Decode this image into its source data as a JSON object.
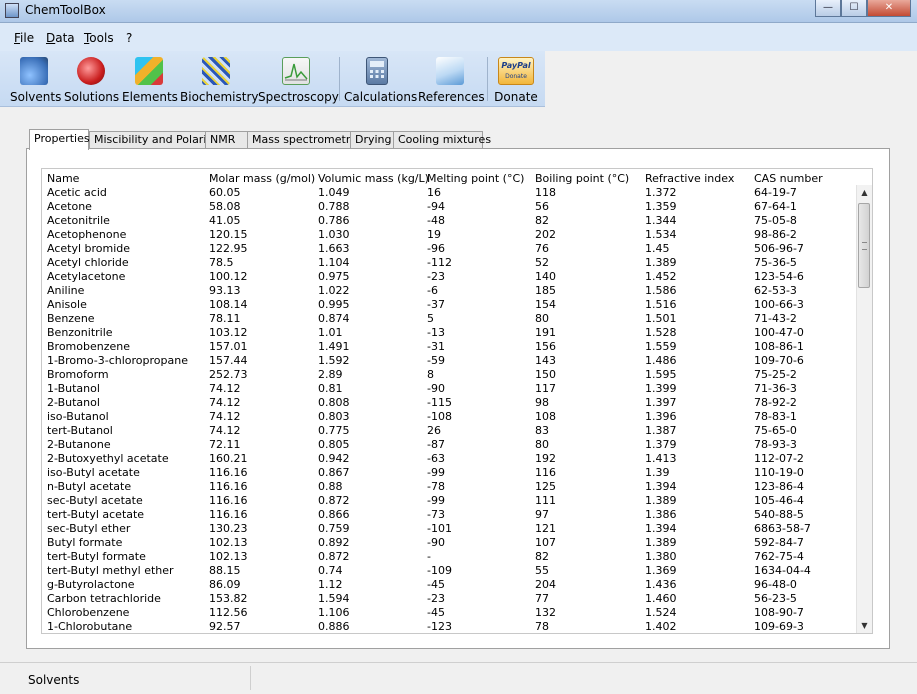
{
  "window": {
    "title": "ChemToolBox",
    "controls": {
      "minimize": "—",
      "maximize": "☐",
      "close": "✕"
    }
  },
  "menu": [
    "File",
    "Data",
    "Tools",
    "?"
  ],
  "toolbar": [
    {
      "label": "Solvents",
      "icon": "solvents-flask-icon",
      "color": "#5b8fd0"
    },
    {
      "label": "Solutions",
      "icon": "solutions-molecule-icon",
      "color": "#d23b3b"
    },
    {
      "label": "Elements",
      "icon": "elements-cubes-icon",
      "color": "#2fa8d6"
    },
    {
      "label": "Biochemistry",
      "icon": "biochemistry-dna-icon",
      "color": "#3b6fc2"
    },
    {
      "label": "Spectroscopy",
      "icon": "spectroscopy-graph-icon",
      "color": "#49a34b"
    },
    {
      "label": "Calculations",
      "icon": "calculator-icon",
      "color": "#6f8db3"
    },
    {
      "label": "References",
      "icon": "references-book-icon",
      "color": "#5b9ad6"
    },
    {
      "label": "Donate",
      "icon": "paypal-donate-icon",
      "color": "#e9a32e",
      "badge_top": "PayPal",
      "badge_bottom": "Donate"
    }
  ],
  "tabs": [
    "Properties",
    "Miscibility and Polarity",
    "NMR",
    "Mass spectrometry",
    "Drying",
    "Cooling mixtures"
  ],
  "active_tab": "Properties",
  "table": {
    "columns": [
      "Name",
      "Molar mass (g/mol)",
      "Volumic mass (kg/L)",
      "Melting point (°C)",
      "Boiling point (°C)",
      "Refractive index",
      "CAS number"
    ],
    "rows": [
      [
        "Acetic acid",
        "60.05",
        "1.049",
        "16",
        "118",
        "1.372",
        "64-19-7"
      ],
      [
        "Acetone",
        "58.08",
        "0.788",
        "-94",
        "56",
        "1.359",
        "67-64-1"
      ],
      [
        "Acetonitrile",
        "41.05",
        "0.786",
        "-48",
        "82",
        "1.344",
        "75-05-8"
      ],
      [
        "Acetophenone",
        "120.15",
        "1.030",
        "19",
        "202",
        "1.534",
        "98-86-2"
      ],
      [
        "Acetyl bromide",
        "122.95",
        "1.663",
        "-96",
        "76",
        "1.45",
        "506-96-7"
      ],
      [
        "Acetyl chloride",
        "78.5",
        "1.104",
        "-112",
        "52",
        "1.389",
        "75-36-5"
      ],
      [
        "Acetylacetone",
        "100.12",
        "0.975",
        "-23",
        "140",
        "1.452",
        "123-54-6"
      ],
      [
        "Aniline",
        "93.13",
        "1.022",
        "-6",
        "185",
        "1.586",
        "62-53-3"
      ],
      [
        "Anisole",
        "108.14",
        "0.995",
        "-37",
        "154",
        "1.516",
        "100-66-3"
      ],
      [
        "Benzene",
        "78.11",
        "0.874",
        "5",
        "80",
        "1.501",
        "71-43-2"
      ],
      [
        "Benzonitrile",
        "103.12",
        "1.01",
        "-13",
        "191",
        "1.528",
        "100-47-0"
      ],
      [
        "Bromobenzene",
        "157.01",
        "1.491",
        "-31",
        "156",
        "1.559",
        "108-86-1"
      ],
      [
        "1-Bromo-3-chloropropane",
        "157.44",
        "1.592",
        "-59",
        "143",
        "1.486",
        "109-70-6"
      ],
      [
        "Bromoform",
        "252.73",
        "2.89",
        "8",
        "150",
        "1.595",
        "75-25-2"
      ],
      [
        "1-Butanol",
        "74.12",
        "0.81",
        "-90",
        "117",
        "1.399",
        "71-36-3"
      ],
      [
        "2-Butanol",
        "74.12",
        "0.808",
        "-115",
        "98",
        "1.397",
        "78-92-2"
      ],
      [
        "iso-Butanol",
        "74.12",
        "0.803",
        "-108",
        "108",
        "1.396",
        "78-83-1"
      ],
      [
        "tert-Butanol",
        "74.12",
        "0.775",
        "26",
        "83",
        "1.387",
        "75-65-0"
      ],
      [
        "2-Butanone",
        "72.11",
        "0.805",
        "-87",
        "80",
        "1.379",
        "78-93-3"
      ],
      [
        "2-Butoxyethyl acetate",
        "160.21",
        "0.942",
        "-63",
        "192",
        "1.413",
        "112-07-2"
      ],
      [
        "iso-Butyl acetate",
        "116.16",
        "0.867",
        "-99",
        "116",
        "1.39",
        "110-19-0"
      ],
      [
        "n-Butyl acetate",
        "116.16",
        "0.88",
        "-78",
        "125",
        "1.394",
        "123-86-4"
      ],
      [
        "sec-Butyl acetate",
        "116.16",
        "0.872",
        "-99",
        "111",
        "1.389",
        "105-46-4"
      ],
      [
        "tert-Butyl acetate",
        "116.16",
        "0.866",
        "-73",
        "97",
        "1.386",
        "540-88-5"
      ],
      [
        "sec-Butyl ether",
        "130.23",
        "0.759",
        "-101",
        "121",
        "1.394",
        "6863-58-7"
      ],
      [
        "Butyl formate",
        "102.13",
        "0.892",
        "-90",
        "107",
        "1.389",
        "592-84-7"
      ],
      [
        "tert-Butyl formate",
        "102.13",
        "0.872",
        "-",
        "82",
        "1.380",
        "762-75-4"
      ],
      [
        "tert-Butyl methyl ether",
        "88.15",
        "0.74",
        "-109",
        "55",
        "1.369",
        "1634-04-4"
      ],
      [
        "g-Butyrolactone",
        "86.09",
        "1.12",
        "-45",
        "204",
        "1.436",
        "96-48-0"
      ],
      [
        "Carbon tetrachloride",
        "153.82",
        "1.594",
        "-23",
        "77",
        "1.460",
        "56-23-5"
      ],
      [
        "Chlorobenzene",
        "112.56",
        "1.106",
        "-45",
        "132",
        "1.524",
        "108-90-7"
      ],
      [
        "1-Chlorobutane",
        "92.57",
        "0.886",
        "-123",
        "78",
        "1.402",
        "109-69-3"
      ]
    ]
  },
  "scrollbar": {
    "up": "▲",
    "down": "▼",
    "position_fraction": 0.0
  },
  "status": {
    "text": "Solvents"
  }
}
